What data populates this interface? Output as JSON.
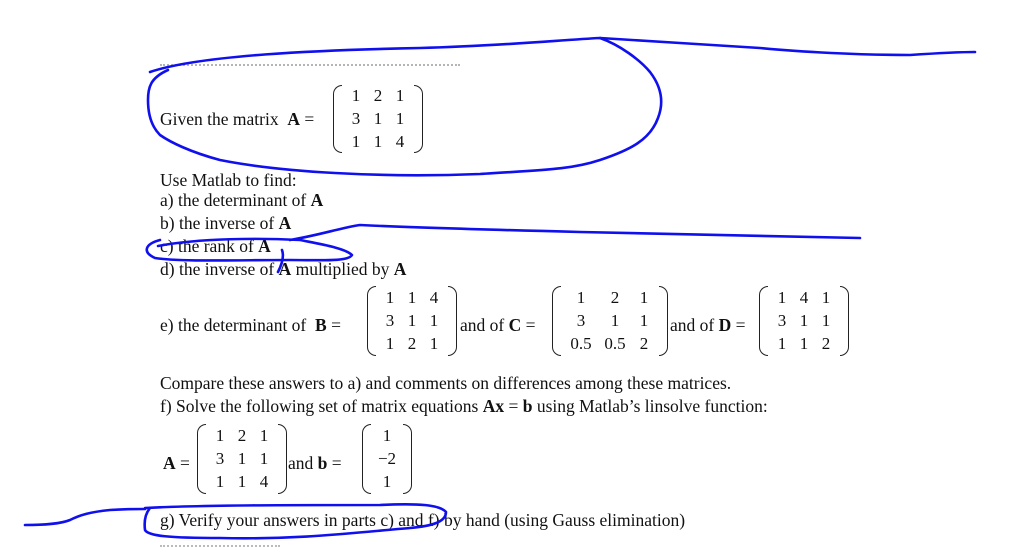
{
  "document": {
    "given_label": "Given the matrix",
    "given_matrix_name": "A",
    "equals": "=",
    "use_matlab": "Use Matlab to find:",
    "items": {
      "a": {
        "text": "a) the determinant of ",
        "bold": "A"
      },
      "b": {
        "text": "b) the inverse of ",
        "bold": "A"
      },
      "c": {
        "text": "c) the rank of ",
        "bold": "A"
      },
      "d": {
        "text": "d) the inverse of ",
        "bold": "A",
        "text2": " multiplied by ",
        "bold2": "A"
      },
      "e": {
        "text": "e) the determinant of ",
        "b_name": "B",
        "and_of_1": " and of ",
        "c_name": "C",
        "and_of_2": " and of ",
        "d_name": "D"
      },
      "compare": "Compare these answers to a) and comments on differences among these matrices.",
      "f": {
        "text": "f) Solve the following set of matrix equations ",
        "bold": "Ax",
        "eq": " = ",
        "bold2": "b",
        "text2": " using Matlab’s linsolve function:"
      },
      "f_and": "and",
      "f_b_name": "b",
      "g": "g) Verify your answers in parts c) and f) by hand (using Gauss elimination)"
    },
    "matrices": {
      "A": [
        [
          "1",
          "2",
          "1"
        ],
        [
          "3",
          "1",
          "1"
        ],
        [
          "1",
          "1",
          "4"
        ]
      ],
      "B": [
        [
          "1",
          "1",
          "4"
        ],
        [
          "3",
          "1",
          "1"
        ],
        [
          "1",
          "2",
          "1"
        ]
      ],
      "C": [
        [
          "1",
          "2",
          "1"
        ],
        [
          "3",
          "1",
          "1"
        ],
        [
          "0.5",
          "0.5",
          "2"
        ]
      ],
      "D": [
        [
          "1",
          "4",
          "1"
        ],
        [
          "3",
          "1",
          "1"
        ],
        [
          "1",
          "1",
          "2"
        ]
      ],
      "b": [
        [
          "1"
        ],
        [
          "−2"
        ],
        [
          "1"
        ]
      ]
    }
  },
  "annotations": {
    "ink_color": "#1010ee",
    "marks": [
      "circle-around-given-matrix",
      "circle-around-item-c",
      "underline-item-c",
      "circle-around-item-g",
      "line-right-of-top",
      "line-left-of-g"
    ]
  }
}
